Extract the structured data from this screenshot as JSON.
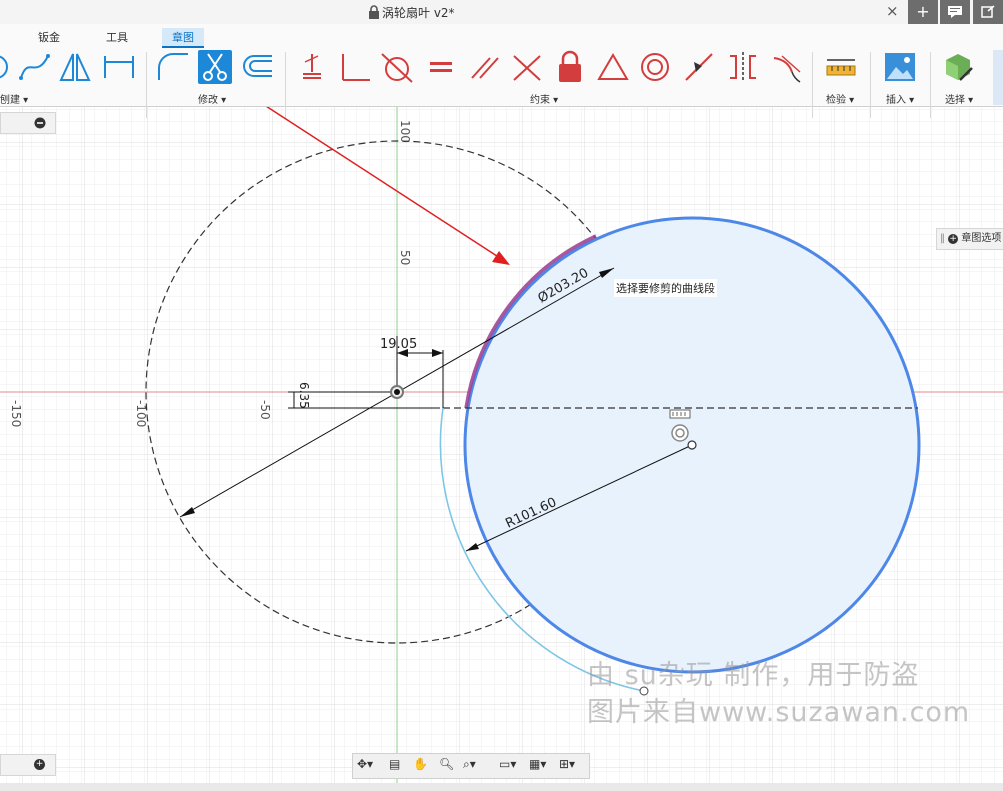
{
  "window": {
    "title": "涡轮扇叶 v2*",
    "close_label": "×"
  },
  "ribbon": {
    "tabs": [
      {
        "label": "钣金"
      },
      {
        "label": "工具"
      },
      {
        "label": "章图"
      }
    ],
    "groups": {
      "create": "刨建 ▾",
      "modify": "修改 ▾",
      "constraints": "约束 ▾",
      "inspect": "检验 ▾",
      "insert": "插入 ▾",
      "select": "选择 ▾"
    }
  },
  "browser_panel": {
    "label": "章图选项"
  },
  "sketch": {
    "grid_labels": {
      "y_100": "100",
      "y_50": "50",
      "x_neg150": "-150",
      "x_neg100": "-100",
      "x_neg50": "-50"
    },
    "dimensions": {
      "diameter": "Ø203.20",
      "horizontal": "19.05",
      "vertical": "6.35",
      "radius": "R101.60"
    },
    "tooltip": "选择要修剪的曲线段"
  },
  "watermark": {
    "line1": "由 su杂玩 制作，用于防盗",
    "line2": "图片来自www.suzawan.com"
  },
  "colors": {
    "accent": "#1e88d8",
    "selected_circle": "#4d87e8",
    "circle_fill": "#e8f2fc",
    "highlight_segment": "#9a3b8f",
    "trim_arc": "#7ec6e8",
    "axis_red": "#e38b8b",
    "axis_green": "#8dd08d",
    "arrow_red": "#e02020",
    "constraint_red": "#d43d3d"
  }
}
